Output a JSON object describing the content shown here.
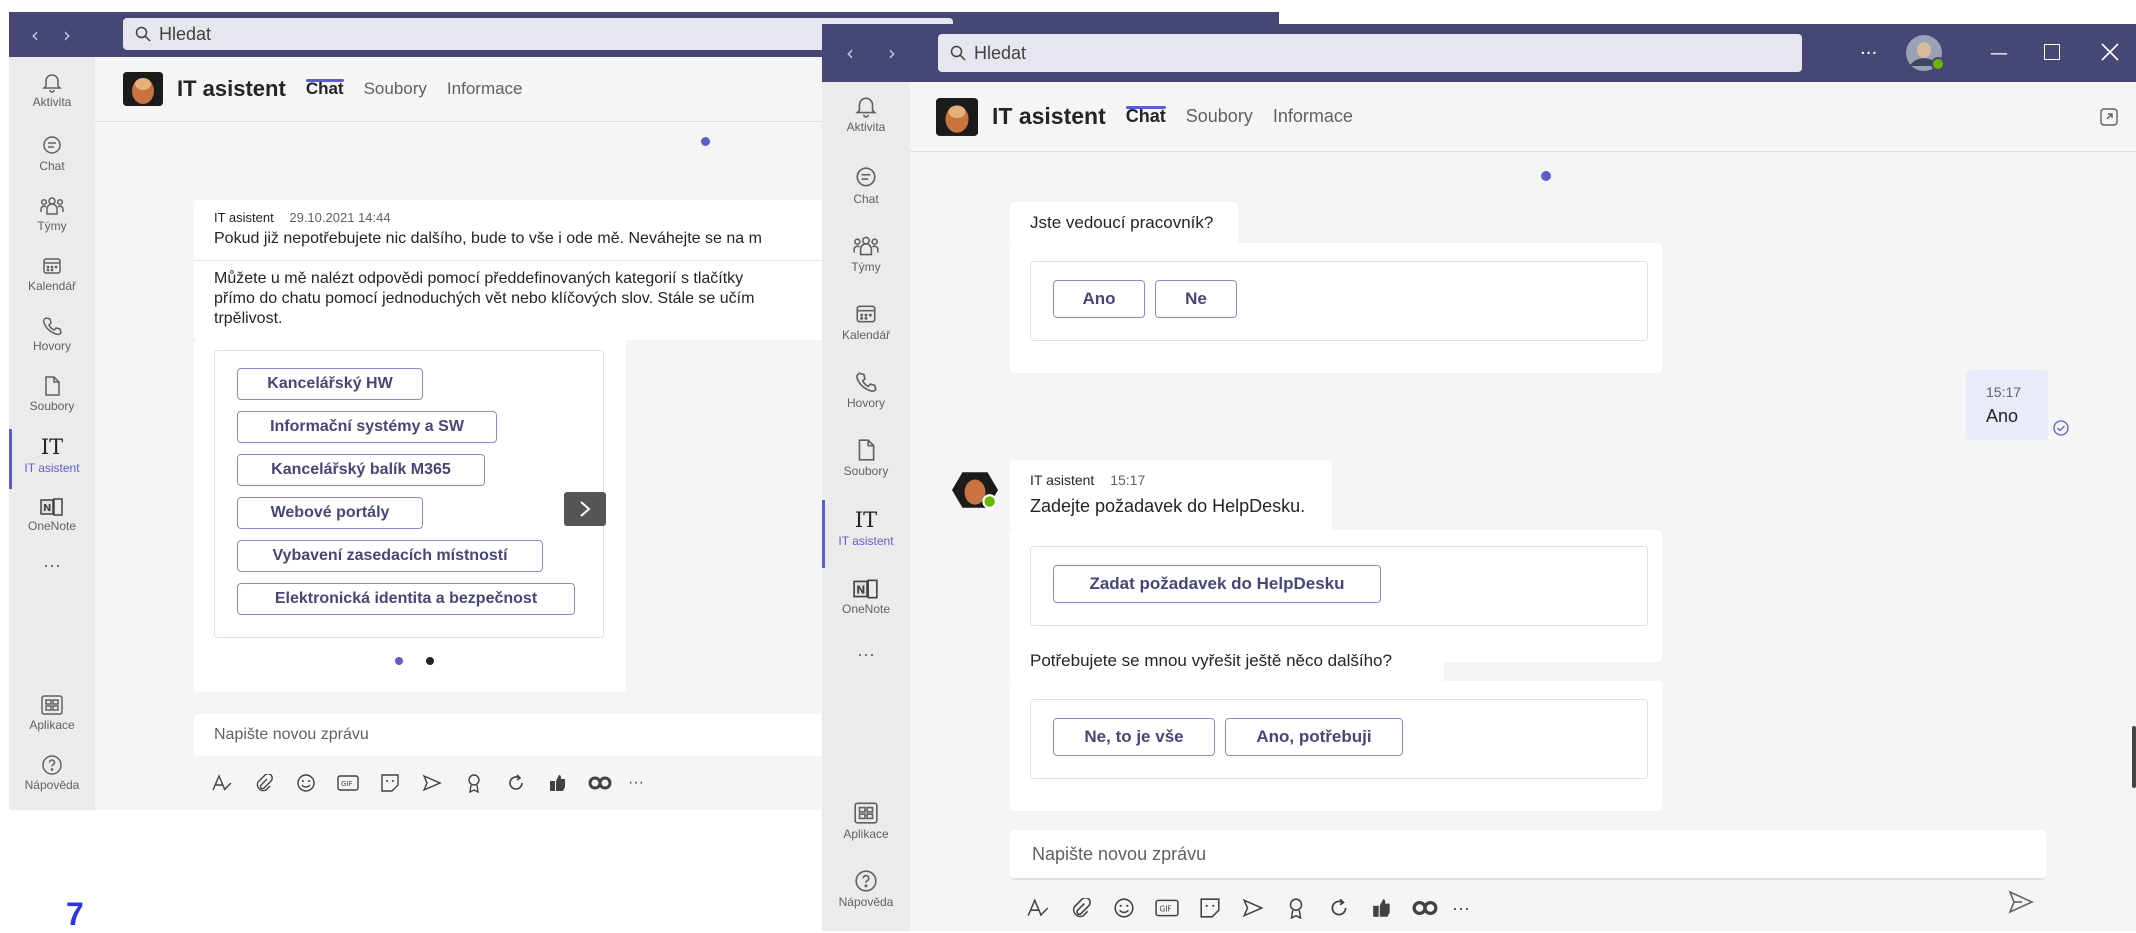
{
  "search": {
    "placeholder": "Hledat"
  },
  "rail": {
    "items": [
      {
        "label": "Aktivita"
      },
      {
        "label": "Chat"
      },
      {
        "label": "Týmy"
      },
      {
        "label": "Kalendář"
      },
      {
        "label": "Hovory"
      },
      {
        "label": "Soubory"
      },
      {
        "label": "IT asistent",
        "glyph": "IT"
      },
      {
        "label": "OneNote"
      }
    ],
    "more": "···",
    "apps": "Aplikace",
    "help": "Nápověda"
  },
  "header": {
    "title": "IT asistent",
    "tabs": [
      {
        "label": "Chat"
      },
      {
        "label": "Soubory"
      },
      {
        "label": "Informace"
      }
    ]
  },
  "back_window": {
    "message": {
      "sender": "IT asistent",
      "timestamp": "29.10.2021 14:44",
      "line1": "Pokud již nepotřebujete nic dalšího, bude to vše i ode mě. Neváhejte se na m",
      "para2_line1": "Můžete u mě nalézt odpovědi pomocí předdefinovaných kategorií s tlačítky",
      "para2_line2": "přímo do chatu pomocí jednoduchých vět nebo klíčových slov. Stále se učím",
      "para2_line3": "trpělivost."
    },
    "categories": [
      "Kancelářský HW",
      "Informační systémy a SW",
      "Kancelářský balík M365",
      "Webové portály",
      "Vybavení zasedacích místností",
      "Elektronická identita a bezpečnost"
    ],
    "compose_placeholder": "Napište novou zprávu"
  },
  "front_window": {
    "q1": "Jste vedoucí pracovník?",
    "q1_buttons": [
      "Ano",
      "Ne"
    ],
    "user_reply": {
      "time": "15:17",
      "text": "Ano"
    },
    "bot_msg": {
      "sender": "IT asistent",
      "time": "15:17",
      "text": "Zadejte požadavek do HelpDesku."
    },
    "helpdesk_button": "Zadat požadavek do HelpDesku",
    "q2": "Potřebujete se mnou vyřešit ještě něco dalšího?",
    "q2_buttons": [
      "Ne, to je vše",
      "Ano, potřebuji"
    ],
    "compose_placeholder": "Napište novou zprávu"
  },
  "page_number": "7",
  "colors": {
    "titlebar": "#464775",
    "accent": "#5b5fc7",
    "rail": "#ebebeb",
    "link_blue": "#2b36e0"
  }
}
